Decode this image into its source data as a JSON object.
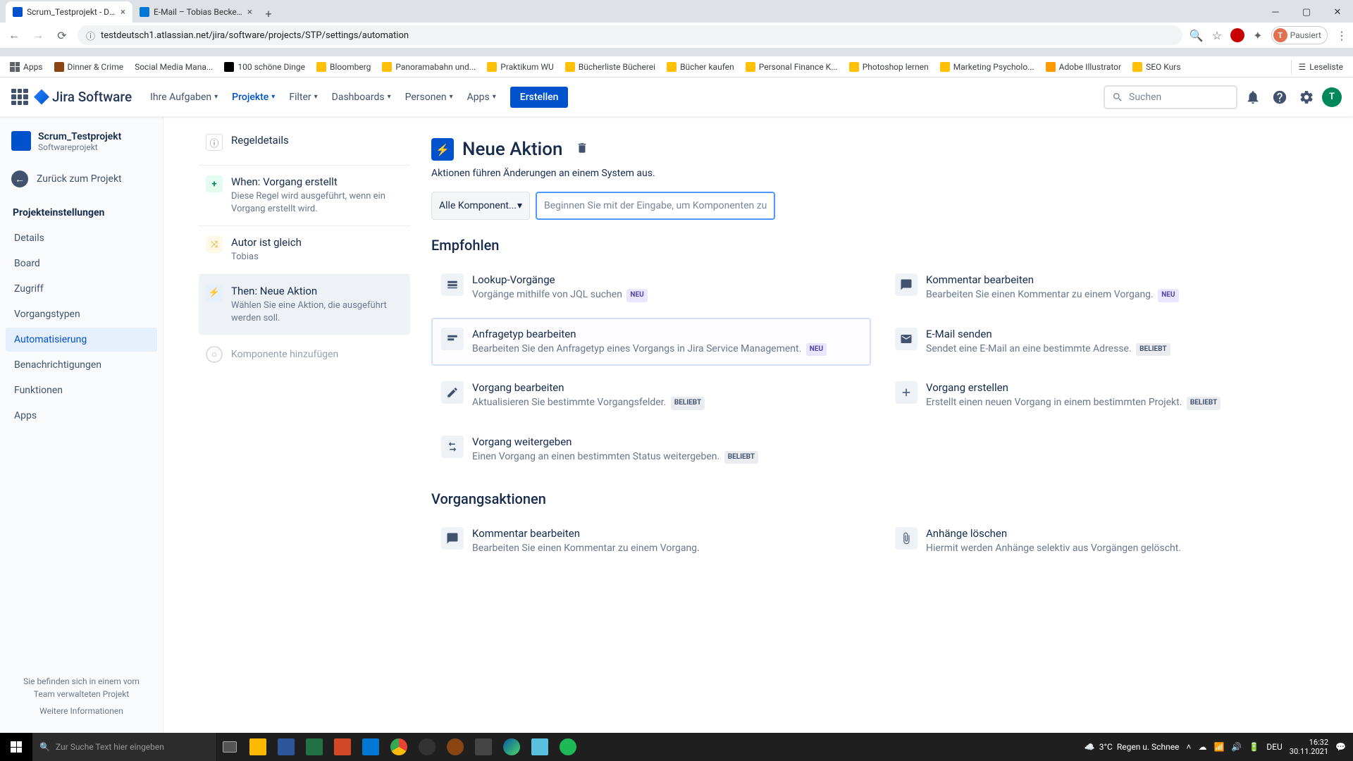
{
  "browser": {
    "tabs": [
      {
        "title": "Scrum_Testprojekt - Details - Jira"
      },
      {
        "title": "E-Mail – Tobias Becker – Outlook"
      }
    ],
    "url": "testdeutsch1.atlassian.net/jira/software/projects/STP/settings/automation",
    "profile_status": "Pausiert",
    "profile_initial": "T",
    "bookmarks": [
      "Apps",
      "Dinner & Crime",
      "Social Media Mana...",
      "100 schöne Dinge",
      "Bloomberg",
      "Panoramabahn und...",
      "Praktikum WU",
      "Bücherliste Bücherei",
      "Bücher kaufen",
      "Personal Finance K...",
      "Photoshop lernen",
      "Marketing Psycholo...",
      "Adobe Illustrator",
      "SEO Kurs"
    ],
    "reading_list": "Leseliste"
  },
  "jira_nav": {
    "product": "Jira Software",
    "items": [
      "Ihre Aufgaben",
      "Projekte",
      "Filter",
      "Dashboards",
      "Personen",
      "Apps"
    ],
    "active_index": 1,
    "create": "Erstellen",
    "search_placeholder": "Suchen",
    "user_initial": "T"
  },
  "sidebar": {
    "project_name": "Scrum_Testprojekt",
    "project_type": "Softwareprojekt",
    "back": "Zurück zum Projekt",
    "section": "Projekteinstellungen",
    "items": [
      "Details",
      "Board",
      "Zugriff",
      "Vorgangstypen",
      "Automatisierung",
      "Benachrichtigungen",
      "Funktionen",
      "Apps"
    ],
    "active_index": 4,
    "footer_line": "Sie befinden sich in einem vom Team verwalteten Projekt",
    "footer_link": "Weitere Informationen"
  },
  "rule": {
    "details": "Regeldetails",
    "steps": [
      {
        "title": "When: Vorgang erstellt",
        "desc": "Diese Regel wird ausgeführt, wenn ein Vorgang erstellt wird."
      },
      {
        "title": "Autor ist gleich",
        "desc": "Tobias"
      },
      {
        "title": "Then: Neue Aktion",
        "desc": "Wählen Sie eine Aktion, die ausgeführt werden soll."
      }
    ],
    "add": "Komponente hinzufügen"
  },
  "action_panel": {
    "title": "Neue Aktion",
    "subtitle": "Aktionen führen Änderungen an einem System aus.",
    "component_select": "Alle Komponent...",
    "filter_placeholder": "Beginnen Sie mit der Eingabe, um Komponenten zu fil",
    "section_recommended": "Empfohlen",
    "section_issues": "Vorgangsaktionen",
    "recommended": [
      {
        "title": "Lookup-Vorgänge",
        "desc": "Vorgänge mithilfe von JQL suchen",
        "badge": "NEU"
      },
      {
        "title": "Kommentar bearbeiten",
        "desc": "Bearbeiten Sie einen Kommentar zu einem Vorgang.",
        "badge": "NEU"
      },
      {
        "title": "Anfragetyp bearbeiten",
        "desc": "Bearbeiten Sie den Anfragetyp eines Vorgangs in Jira Service Management.",
        "badge": "NEU"
      },
      {
        "title": "E-Mail senden",
        "desc": "Sendet eine E-Mail an eine bestimmte Adresse.",
        "badge": "BELIEBT"
      },
      {
        "title": "Vorgang bearbeiten",
        "desc": "Aktualisieren Sie bestimmte Vorgangsfelder.",
        "badge": "BELIEBT"
      },
      {
        "title": "Vorgang erstellen",
        "desc": "Erstellt einen neuen Vorgang in einem bestimmten Projekt.",
        "badge": "BELIEBT"
      },
      {
        "title": "Vorgang weitergeben",
        "desc": "Einen Vorgang an einen bestimmten Status weitergeben.",
        "badge": "BELIEBT"
      }
    ],
    "issue_actions": [
      {
        "title": "Kommentar bearbeiten",
        "desc": "Bearbeiten Sie einen Kommentar zu einem Vorgang."
      },
      {
        "title": "Anhänge löschen",
        "desc": "Hiermit werden Anhänge selektiv aus Vorgängen gelöscht."
      }
    ]
  },
  "taskbar": {
    "search_placeholder": "Zur Suche Text hier eingeben",
    "weather_temp": "3°C",
    "weather_text": "Regen u. Schnee",
    "lang": "DEU",
    "time": "16:32",
    "date": "30.11.2021"
  }
}
